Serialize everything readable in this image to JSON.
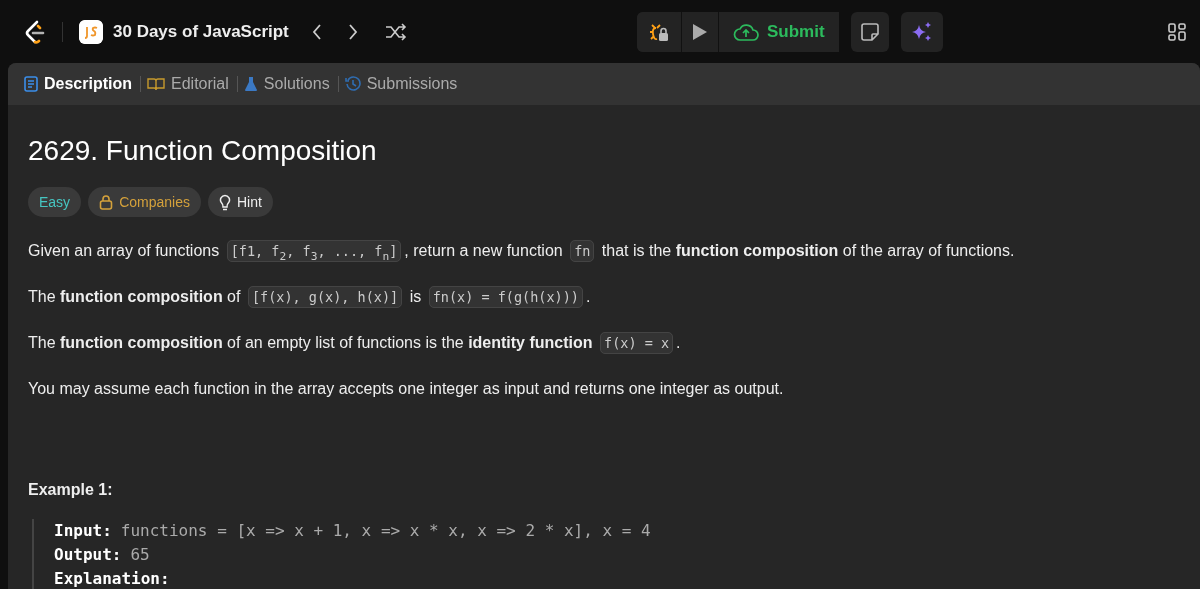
{
  "header": {
    "course": "30 Days of JavaScript",
    "submit": "Submit"
  },
  "tabs": [
    {
      "label": "Description",
      "kind": "description",
      "selected": true
    },
    {
      "label": "Editorial",
      "kind": "editorial",
      "selected": false
    },
    {
      "label": "Solutions",
      "kind": "solutions",
      "selected": false
    },
    {
      "label": "Submissions",
      "kind": "submissions",
      "selected": false
    }
  ],
  "title": "2629. Function Composition",
  "tags": [
    {
      "label": "Easy",
      "kind": "difficulty"
    },
    {
      "label": "Companies",
      "kind": "companies"
    },
    {
      "label": "Hint",
      "kind": "hint"
    }
  ],
  "paragraphs": [
    {
      "segments": [
        {
          "kind": "text",
          "text": "Given an array of functions"
        },
        {
          "kind": "code",
          "text": "[f1, f$_{2}$, f$_{3}$, ..., f$_{n}$]"
        },
        {
          "kind": "text",
          "text": ", return a new function"
        },
        {
          "kind": "code",
          "text": "fn"
        },
        {
          "kind": "text",
          "text": "that is the **function composition** of the array of functions."
        }
      ]
    },
    {
      "segments": [
        {
          "kind": "text",
          "text": "The **function composition** of"
        },
        {
          "kind": "code",
          "text": "[f(x), g(x), h(x)]"
        },
        {
          "kind": "text",
          "text": "is"
        },
        {
          "kind": "code",
          "text": "fn(x) = f(g(h(x)))"
        },
        {
          "kind": "text",
          "text": "."
        }
      ]
    },
    {
      "segments": [
        {
          "kind": "text",
          "text": "The **function composition** of an empty list of functions is the **identity function**"
        },
        {
          "kind": "code",
          "text": "f(x) = x"
        },
        {
          "kind": "text",
          "text": "."
        }
      ]
    },
    {
      "segments": [
        {
          "kind": "text",
          "text": "You may assume each function in the array accepts one integer as input and returns one integer as output."
        }
      ]
    }
  ],
  "example": {
    "heading": "Example 1:",
    "lines": [
      {
        "label": "Input:",
        "value": "functions = [x => x + 1, x => x * x, x => 2 * x], x = 4"
      },
      {
        "label": "Output:",
        "value": "65"
      },
      {
        "label": "Explanation:"
      }
    ]
  }
}
